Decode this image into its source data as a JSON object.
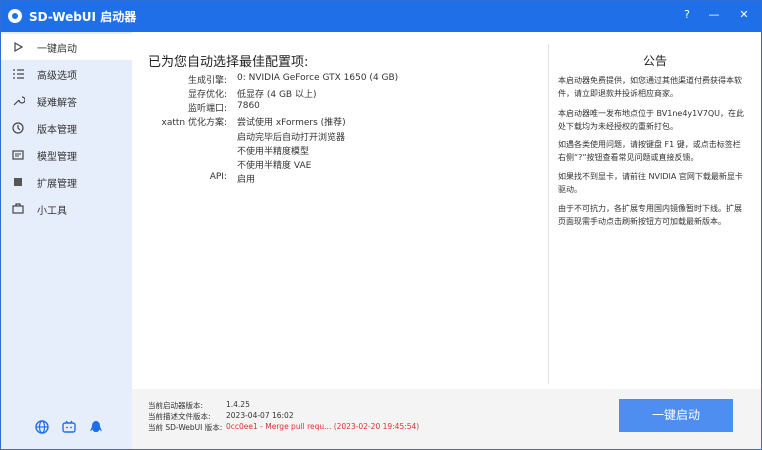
{
  "window": {
    "title": "SD-WebUI 启动器",
    "help_label": "?",
    "minimize_label": "—",
    "close_label": "✕"
  },
  "sidebar": {
    "items": [
      {
        "label": "一键启动",
        "icon": "play-icon"
      },
      {
        "label": "高级选项",
        "icon": "list-icon"
      },
      {
        "label": "疑难解答",
        "icon": "wrench-icon"
      },
      {
        "label": "版本管理",
        "icon": "history-icon"
      },
      {
        "label": "模型管理",
        "icon": "model-icon"
      },
      {
        "label": "扩展管理",
        "icon": "extension-icon"
      },
      {
        "label": "小工具",
        "icon": "toolbox-icon"
      }
    ],
    "bottom_icons": [
      "globe-icon",
      "bilibili-icon",
      "qq-icon"
    ]
  },
  "main": {
    "config_title": "已为您自动选择最佳配置项:",
    "config": [
      {
        "key": "生成引擎:",
        "value": "0: NVIDIA GeForce GTX 1650 (4 GB)"
      },
      {
        "key": "显存优化:",
        "value": "低显存 (4 GB 以上)"
      },
      {
        "key": "监听端口:",
        "value": "7860"
      },
      {
        "key": "xattn 优化方案:",
        "value": "尝试使用 xFormers (推荐)"
      },
      {
        "key": "",
        "value": "启动完毕后自动打开浏览器"
      },
      {
        "key": "",
        "value": "不使用半精度模型"
      },
      {
        "key": "",
        "value": "不使用半精度 VAE"
      },
      {
        "key": "API:",
        "value": "启用"
      }
    ]
  },
  "notice": {
    "title": "公告",
    "paragraphs": [
      "本启动器免费提供，如您通过其他渠道付费获得本软件，请立即退款并投诉相应商家。",
      "本启动器唯一发布地点位于 BV1ne4y1V7QU，在此处下载均为未经授权的重新打包。",
      "如遇各类使用问题，请按键盘 F1 键，或点击标签栏右侧“?”按钮查看常见问题或直接反馈。",
      "如果找不到显卡，请前往 NVIDIA 官网下载最新显卡驱动。",
      "由于不可抗力，各扩展专用国内镜像暂时下线。扩展页面现需手动点击刷新按钮方可加载最新版本。"
    ]
  },
  "footer": {
    "versions": [
      {
        "key": "当前启动器版本:",
        "value": "1.4.25",
        "highlight": false
      },
      {
        "key": "当前描述文件版本:",
        "value": "2023-04-07 16:02",
        "highlight": false
      },
      {
        "key": "当前 SD-WebUI 版本:",
        "value": "0cc0ee1 - Merge pull requ... (2023-02-20 19:45:54)",
        "highlight": true
      }
    ],
    "launch_label": "一键启动"
  },
  "colors": {
    "accent": "#1e6fe8",
    "button": "#4d8ef0",
    "sidebar_bg": "#e7eefb",
    "warning_text": "#e03030"
  }
}
